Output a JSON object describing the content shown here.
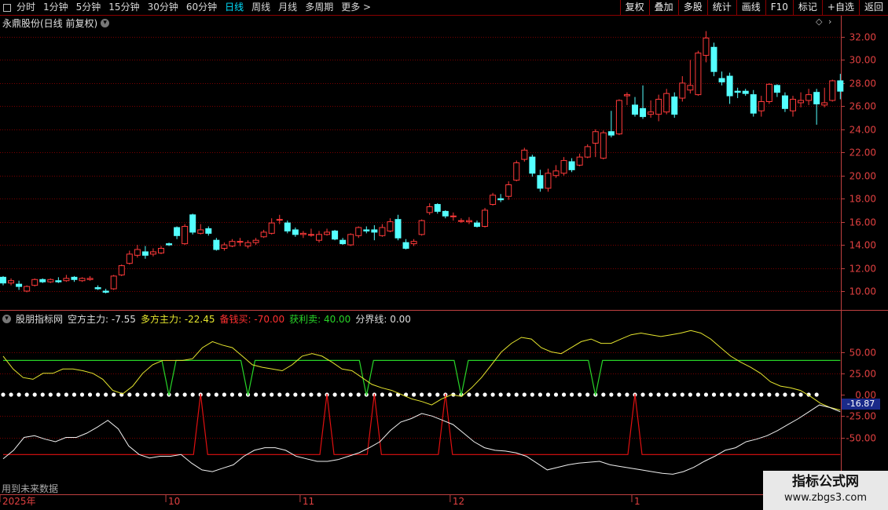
{
  "toolbar": {
    "periods": [
      "分时",
      "1分钟",
      "5分钟",
      "15分钟",
      "30分钟",
      "60分钟",
      "日线",
      "周线",
      "月线",
      "多周期",
      "更多 >"
    ],
    "active_index": 6,
    "buttons": [
      "复权",
      "叠加",
      "多股",
      "统计",
      "画线",
      "F10",
      "标记",
      "+自选",
      "返回"
    ]
  },
  "title": "永鼎股份(日线 前复权)",
  "indicator": {
    "name": "股朋指标网",
    "kong_label": "空方主力:",
    "kong_value": "-7.55",
    "duo_label": "多方主力:",
    "duo_value": "-22.45",
    "bei_label": "备钱买:",
    "bei_value": "-70.00",
    "huo_label": "获利卖:",
    "huo_value": "40.00",
    "fen_label": "分界线:",
    "fen_value": "0.00",
    "current_label": "-16.87"
  },
  "future_tag": "用到未来数据",
  "watermark": {
    "main": "指标公式网",
    "sub": "www.zbgs3.com"
  },
  "colors": {
    "up": "#ff3a3a",
    "down": "#54ffff",
    "yellow": "#e6e62e",
    "green": "#28d428",
    "red": "#e01010",
    "grid": "#7a0000",
    "axis": "#c04040"
  },
  "chart_data": {
    "type": "candlestick",
    "y_ticks": [
      "32.00",
      "30.00",
      "28.00",
      "26.00",
      "24.00",
      "22.00",
      "20.00",
      "18.00",
      "16.00",
      "14.00",
      "12.00",
      "10.00"
    ],
    "ylim": [
      9,
      33
    ],
    "x_labels": [
      "2025年",
      "10",
      "11",
      "12",
      "1"
    ],
    "x_label_index": [
      0,
      21,
      38,
      57,
      80
    ],
    "candles": [
      [
        11.2,
        10.7,
        11.3,
        10.5
      ],
      [
        10.7,
        10.9,
        11.1,
        10.5
      ],
      [
        10.6,
        10.4,
        10.9,
        10.1
      ],
      [
        10.0,
        10.4,
        10.5,
        9.9
      ],
      [
        10.5,
        11.0,
        11.1,
        10.4
      ],
      [
        11.0,
        10.8,
        11.1,
        10.7
      ],
      [
        10.8,
        11.0,
        11.1,
        10.7
      ],
      [
        10.9,
        10.8,
        11.2,
        10.7
      ],
      [
        10.9,
        11.1,
        11.4,
        10.8
      ],
      [
        11.2,
        11.0,
        11.3,
        10.8
      ],
      [
        10.9,
        11.1,
        11.2,
        10.8
      ],
      [
        11.0,
        11.1,
        11.3,
        10.9
      ],
      [
        10.3,
        10.2,
        10.5,
        10.1
      ],
      [
        10.0,
        9.9,
        10.2,
        9.8
      ],
      [
        10.2,
        11.3,
        11.4,
        10.1
      ],
      [
        11.4,
        12.2,
        12.3,
        11.3
      ],
      [
        12.4,
        13.2,
        13.5,
        12.3
      ],
      [
        13.1,
        13.6,
        14.0,
        12.9
      ],
      [
        13.4,
        13.1,
        13.9,
        12.8
      ],
      [
        13.2,
        13.4,
        13.7,
        13.0
      ],
      [
        13.3,
        13.7,
        13.9,
        13.2
      ],
      [
        14.1,
        14.0,
        14.2,
        13.9
      ],
      [
        15.5,
        14.8,
        15.6,
        14.5
      ],
      [
        14.1,
        15.6,
        15.8,
        14.0
      ],
      [
        16.6,
        15.1,
        16.7,
        14.9
      ],
      [
        15.0,
        15.3,
        15.8,
        14.9
      ],
      [
        15.4,
        15.0,
        15.6,
        14.8
      ],
      [
        14.4,
        13.6,
        14.6,
        13.5
      ],
      [
        13.7,
        14.0,
        14.2,
        13.5
      ],
      [
        13.9,
        14.3,
        14.5,
        13.8
      ],
      [
        14.3,
        14.3,
        14.6,
        13.9
      ],
      [
        13.9,
        14.2,
        14.4,
        13.7
      ],
      [
        14.2,
        14.4,
        14.6,
        14.0
      ],
      [
        14.7,
        15.1,
        15.3,
        14.6
      ],
      [
        15.0,
        15.9,
        16.3,
        14.9
      ],
      [
        16.2,
        16.2,
        16.6,
        15.8
      ],
      [
        15.9,
        15.2,
        16.1,
        15.0
      ],
      [
        15.3,
        14.9,
        15.5,
        14.7
      ],
      [
        14.9,
        15.0,
        15.2,
        14.6
      ],
      [
        14.9,
        14.9,
        15.4,
        14.7
      ],
      [
        14.4,
        14.9,
        15.2,
        14.2
      ],
      [
        14.9,
        15.1,
        15.4,
        14.8
      ],
      [
        15.2,
        14.5,
        15.3,
        14.4
      ],
      [
        14.4,
        14.1,
        14.6,
        14.0
      ],
      [
        14.0,
        14.9,
        15.0,
        13.9
      ],
      [
        14.8,
        15.5,
        15.6,
        14.6
      ],
      [
        15.3,
        15.2,
        15.6,
        15.0
      ],
      [
        15.3,
        15.1,
        15.7,
        14.4
      ],
      [
        14.8,
        15.5,
        15.8,
        14.7
      ],
      [
        15.2,
        16.0,
        16.3,
        15.1
      ],
      [
        16.2,
        14.6,
        16.6,
        14.4
      ],
      [
        14.2,
        13.7,
        14.5,
        13.6
      ],
      [
        14.1,
        14.3,
        14.5,
        13.9
      ],
      [
        14.9,
        16.1,
        16.2,
        14.8
      ],
      [
        16.8,
        17.3,
        17.6,
        16.6
      ],
      [
        17.5,
        16.9,
        17.6,
        16.7
      ],
      [
        16.9,
        16.5,
        17.0,
        16.3
      ],
      [
        16.5,
        16.5,
        16.8,
        16.1
      ],
      [
        16.1,
        16.1,
        16.3,
        15.9
      ],
      [
        16.0,
        16.1,
        16.4,
        15.8
      ],
      [
        15.9,
        15.6,
        16.1,
        15.5
      ],
      [
        15.6,
        17.0,
        17.2,
        15.5
      ],
      [
        17.5,
        18.3,
        18.5,
        17.4
      ],
      [
        18.0,
        17.9,
        18.4,
        17.7
      ],
      [
        18.2,
        19.2,
        19.5,
        17.9
      ],
      [
        19.6,
        21.1,
        21.3,
        19.5
      ],
      [
        21.4,
        22.2,
        22.4,
        21.2
      ],
      [
        21.6,
        20.2,
        21.8,
        19.9
      ],
      [
        20.0,
        18.9,
        20.5,
        18.6
      ],
      [
        18.9,
        20.2,
        20.6,
        18.6
      ],
      [
        20.0,
        20.4,
        20.9,
        19.8
      ],
      [
        20.2,
        21.3,
        21.6,
        20.0
      ],
      [
        21.2,
        20.5,
        21.5,
        20.3
      ],
      [
        20.9,
        21.6,
        21.9,
        20.8
      ],
      [
        21.6,
        22.5,
        22.7,
        21.5
      ],
      [
        22.8,
        23.8,
        24.0,
        21.6
      ],
      [
        21.5,
        23.7,
        23.9,
        21.4
      ],
      [
        23.8,
        23.5,
        25.6,
        23.3
      ],
      [
        23.6,
        26.5,
        26.6,
        23.5
      ],
      [
        26.9,
        27.0,
        27.2,
        26.1
      ],
      [
        26.1,
        25.3,
        26.8,
        25.1
      ],
      [
        25.8,
        25.1,
        27.8,
        24.9
      ],
      [
        25.3,
        25.5,
        26.5,
        25.0
      ],
      [
        25.3,
        26.6,
        27.0,
        24.7
      ],
      [
        25.5,
        27.1,
        27.5,
        25.3
      ],
      [
        26.8,
        25.3,
        27.2,
        25.0
      ],
      [
        26.7,
        28.0,
        28.6,
        26.4
      ],
      [
        27.4,
        27.8,
        30.0,
        27.1
      ],
      [
        27.0,
        30.6,
        30.8,
        26.9
      ],
      [
        30.4,
        31.9,
        32.5,
        29.8
      ],
      [
        31.1,
        29.0,
        31.5,
        28.6
      ],
      [
        28.4,
        28.1,
        29.0,
        27.8
      ],
      [
        28.6,
        26.9,
        28.9,
        26.2
      ],
      [
        27.3,
        27.2,
        27.6,
        26.7
      ],
      [
        27.3,
        27.1,
        27.5,
        26.9
      ],
      [
        27.0,
        25.4,
        27.4,
        25.1
      ],
      [
        25.6,
        26.4,
        26.9,
        25.1
      ],
      [
        26.4,
        27.9,
        28.0,
        26.2
      ],
      [
        27.8,
        27.2,
        27.9,
        26.8
      ],
      [
        26.9,
        25.8,
        27.2,
        25.5
      ],
      [
        25.6,
        26.6,
        26.9,
        25.1
      ],
      [
        26.3,
        26.5,
        27.2,
        25.9
      ],
      [
        26.5,
        27.0,
        27.5,
        26.1
      ],
      [
        27.2,
        26.2,
        27.5,
        24.4
      ],
      [
        26.1,
        26.3,
        27.6,
        25.9
      ],
      [
        26.5,
        28.2,
        28.3,
        26.4
      ],
      [
        28.2,
        27.3,
        28.8,
        26.6
      ]
    ],
    "indicator": {
      "ylim": [
        -100,
        100
      ],
      "y_ticks": [
        "50.00",
        "25.00",
        "0.00",
        "-25.00",
        "-50.00"
      ],
      "green_base": 40,
      "green_dip": -1,
      "green_dips": [
        21,
        31,
        46,
        58,
        75
      ],
      "red_base": -70,
      "red_spike": 1,
      "red_spikes": [
        25,
        41,
        47,
        56,
        80
      ],
      "yellow": [
        45,
        30,
        20,
        18,
        25,
        25,
        30,
        30,
        28,
        25,
        18,
        5,
        1,
        10,
        25,
        35,
        40,
        40,
        40,
        42,
        55,
        62,
        58,
        55,
        45,
        35,
        32,
        30,
        28,
        35,
        45,
        48,
        45,
        38,
        30,
        28,
        20,
        12,
        8,
        5,
        0,
        -5,
        -8,
        -12,
        -5,
        0,
        -2,
        8,
        20,
        35,
        50,
        60,
        67,
        65,
        55,
        50,
        48,
        55,
        62,
        65,
        60,
        60,
        65,
        70,
        72,
        70,
        68,
        70,
        72,
        75,
        72,
        65,
        55,
        45,
        38,
        32,
        25,
        15,
        10,
        8,
        5,
        -2,
        -10,
        -15,
        -18
      ],
      "white": [
        -75,
        -65,
        -50,
        -48,
        -52,
        -55,
        -50,
        -50,
        -45,
        -38,
        -30,
        -40,
        -60,
        -70,
        -74,
        -72,
        -72,
        -70,
        -80,
        -88,
        -90,
        -86,
        -82,
        -72,
        -65,
        -62,
        -62,
        -65,
        -72,
        -75,
        -78,
        -78,
        -76,
        -72,
        -68,
        -62,
        -55,
        -42,
        -32,
        -28,
        -22,
        -25,
        -30,
        -35,
        -45,
        -55,
        -62,
        -65,
        -66,
        -68,
        -72,
        -80,
        -88,
        -85,
        -82,
        -80,
        -79,
        -78,
        -82,
        -84,
        -86,
        -88,
        -90,
        -92,
        -93,
        -90,
        -85,
        -78,
        -72,
        -65,
        -62,
        -55,
        -52,
        -48,
        -42,
        -35,
        -28,
        -20,
        -12,
        -15,
        -20
      ]
    }
  }
}
